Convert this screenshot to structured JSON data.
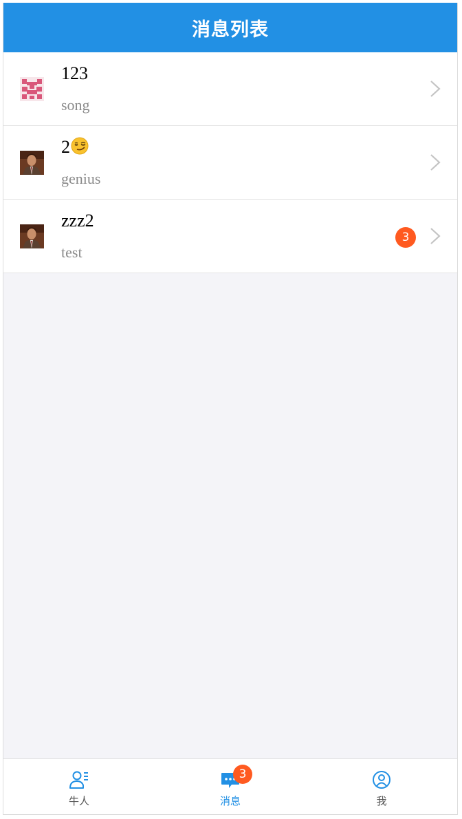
{
  "header": {
    "title": "消息列表"
  },
  "conversations": [
    {
      "name": "123",
      "last_message": "song",
      "avatar_icon": "pixel-pattern-avatar",
      "unread": null
    },
    {
      "name": "2",
      "name_emoji": "smirking-face-emoji",
      "last_message": "genius",
      "avatar_icon": "portrait-avatar",
      "unread": null
    },
    {
      "name": "zzz2",
      "last_message": "test",
      "avatar_icon": "portrait-avatar",
      "unread": "3"
    }
  ],
  "tabbar": {
    "tabs": [
      {
        "label": "牛人",
        "icon": "people-list-icon",
        "active": false
      },
      {
        "label": "消息",
        "icon": "chat-bubble-icon",
        "active": true,
        "badge": "3"
      },
      {
        "label": "我",
        "icon": "user-circle-icon",
        "active": false
      }
    ]
  },
  "colors": {
    "header_bg": "#2290e4",
    "accent": "#2290e4",
    "badge": "#ff5a20",
    "page_bg": "#f4f4f8"
  }
}
